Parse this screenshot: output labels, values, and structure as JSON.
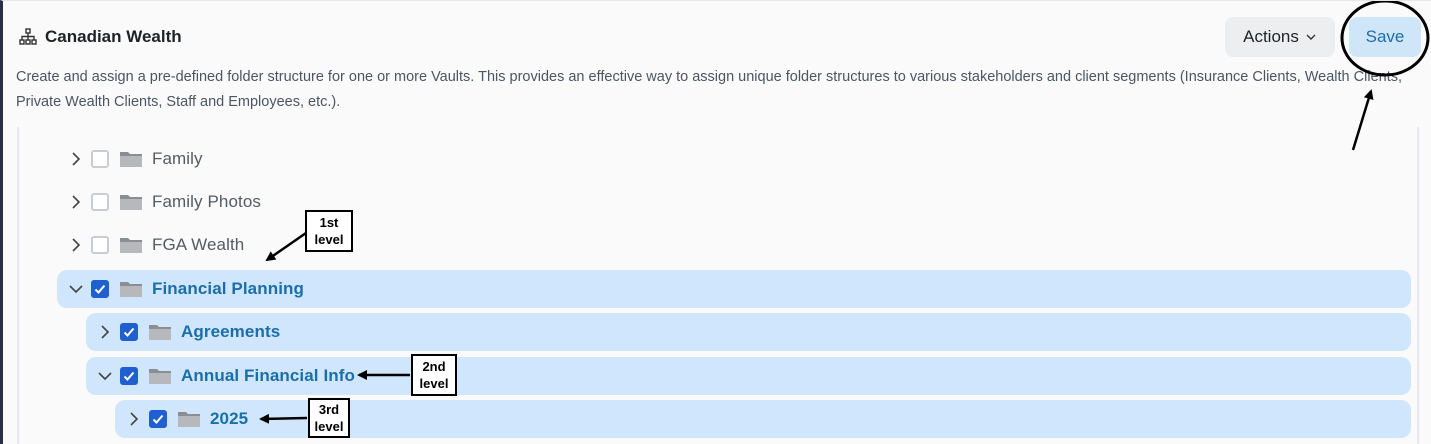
{
  "header": {
    "icon": "sitemap-icon",
    "title": "Canadian Wealth",
    "description": "Create and assign a pre-defined folder structure for one or more Vaults. This provides an effective way to assign unique folder structures to various stakeholders and client segments (Insurance Clients, Wealth Clients, Private Wealth Clients, Staff and Employees, etc.)."
  },
  "toolbar": {
    "actions_label": "Actions",
    "save_label": "Save"
  },
  "tree": {
    "items": [
      {
        "label": "Family",
        "checked": false,
        "expanded": false
      },
      {
        "label": "Family Photos",
        "checked": false,
        "expanded": false
      },
      {
        "label": "FGA Wealth",
        "checked": false,
        "expanded": false
      },
      {
        "label": "Financial Planning",
        "checked": true,
        "expanded": true
      },
      {
        "label": "Agreements",
        "checked": true,
        "expanded": false
      },
      {
        "label": "Annual Financial Info",
        "checked": true,
        "expanded": true
      },
      {
        "label": "2025",
        "checked": true,
        "expanded": false
      }
    ]
  },
  "annotations": {
    "first": "1st level",
    "second": "2nd level",
    "third": "3rd level"
  },
  "colors": {
    "selected_row": "#cfe6fc",
    "selected_text": "#1b6ea8",
    "checkbox_checked": "#1f5fcf"
  }
}
